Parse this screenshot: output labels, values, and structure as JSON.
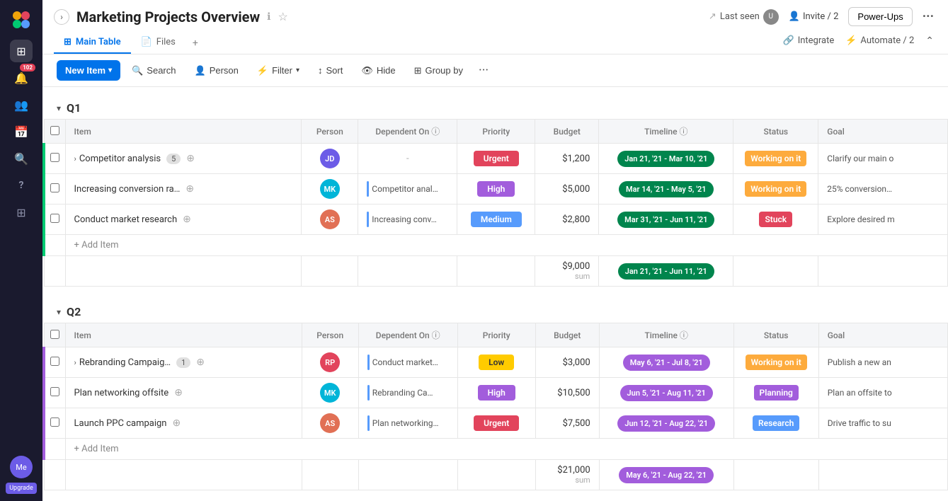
{
  "app": {
    "title": "Marketing Projects Overview",
    "info_icon": "ℹ",
    "star_icon": "☆"
  },
  "header": {
    "last_seen_label": "Last seen",
    "invite_label": "Invite / 2",
    "power_ups_label": "Power-Ups",
    "integrate_label": "Integrate",
    "automate_label": "Automate / 2"
  },
  "tabs": [
    {
      "label": "Main Table",
      "icon": "⊞",
      "active": true
    },
    {
      "label": "Files",
      "icon": "📄",
      "active": false
    }
  ],
  "toolbar": {
    "new_item_label": "New Item",
    "search_label": "Search",
    "person_label": "Person",
    "filter_label": "Filter",
    "sort_label": "Sort",
    "hide_label": "Hide",
    "group_by_label": "Group by"
  },
  "groups": [
    {
      "id": "q1",
      "label": "Q1",
      "color": "#00ca72",
      "columns": [
        "Item",
        "Person",
        "Dependent On",
        "Priority",
        "Budget",
        "Timeline",
        "Status",
        "Goal"
      ],
      "rows": [
        {
          "id": "r1",
          "item": "Competitor analysis",
          "count": 5,
          "expandable": true,
          "person_color": "#6c5ce7",
          "person_initials": "JD",
          "dep_text": "-",
          "dep_bar": false,
          "priority": "Urgent",
          "priority_class": "priority-urgent",
          "budget": "$1,200",
          "timeline": "Jan 21, '21 - Mar 10, '21",
          "status": "Working on it",
          "status_class": "status-working",
          "goal": "Clarify our main o"
        },
        {
          "id": "r2",
          "item": "Increasing conversion ra…",
          "count": null,
          "expandable": false,
          "person_color": "#00b5d8",
          "person_initials": "MK",
          "dep_text": "Competitor anal…",
          "dep_bar": true,
          "priority": "High",
          "priority_class": "priority-high",
          "budget": "$5,000",
          "timeline": "Mar 14, '21 - May 5, '21",
          "status": "Working on it",
          "status_class": "status-working",
          "goal": "25% conversion…"
        },
        {
          "id": "r3",
          "item": "Conduct market research",
          "count": null,
          "expandable": false,
          "person_color": "#e17055",
          "person_initials": "AS",
          "dep_text": "Increasing conv…",
          "dep_bar": true,
          "priority": "Medium",
          "priority_class": "priority-medium",
          "budget": "$2,800",
          "timeline": "Mar 31, '21 - Jun 11, '21",
          "status": "Stuck",
          "status_class": "status-stuck",
          "goal": "Explore desired m"
        }
      ],
      "sum_budget": "$9,000",
      "sum_budget_label": "sum",
      "sum_timeline": "Jan 21, '21 - Jun 11, '21"
    },
    {
      "id": "q2",
      "label": "Q2",
      "color": "#a25ddc",
      "columns": [
        "Item",
        "Person",
        "Dependent On",
        "Priority",
        "Budget",
        "Timeline",
        "Status",
        "Goal"
      ],
      "rows": [
        {
          "id": "r4",
          "item": "Rebranding Campaig…",
          "count": 1,
          "expandable": true,
          "person_color": "#e2445c",
          "person_initials": "RP",
          "dep_text": "Conduct market…",
          "dep_bar": true,
          "priority": "Low",
          "priority_class": "priority-low",
          "budget": "$3,000",
          "timeline": "May 6, '21 - Jul 8, '21",
          "status": "Working on it",
          "status_class": "status-working",
          "goal": "Publish a new an"
        },
        {
          "id": "r5",
          "item": "Plan networking offsite",
          "count": null,
          "expandable": false,
          "person_color": "#00b5d8",
          "person_initials": "MK",
          "dep_text": "Rebranding Ca…",
          "dep_bar": true,
          "priority": "High",
          "priority_class": "priority-high",
          "budget": "$10,500",
          "timeline": "Jun 5, '21 - Aug 11, '21",
          "status": "Planning",
          "status_class": "status-planning",
          "goal": "Plan an offsite to"
        },
        {
          "id": "r6",
          "item": "Launch PPC campaign",
          "count": null,
          "expandable": false,
          "person_color": "#e17055",
          "person_initials": "AS",
          "dep_text": "Plan networking…",
          "dep_bar": true,
          "priority": "Urgent",
          "priority_class": "priority-urgent",
          "budget": "$7,500",
          "timeline": "Jun 12, '21 - Aug 22, '21",
          "status": "Research",
          "status_class": "status-research",
          "goal": "Drive traffic to su"
        }
      ],
      "sum_budget": "$21,000",
      "sum_budget_label": "sum",
      "sum_timeline": "May 6, '21 - Aug 22, '21"
    }
  ],
  "sidebar": {
    "icons": [
      "⊞",
      "🔔",
      "👥",
      "📅",
      "🔍",
      "?",
      "⊞"
    ],
    "badge_count": "102",
    "upgrade_label": "Upgrade"
  }
}
